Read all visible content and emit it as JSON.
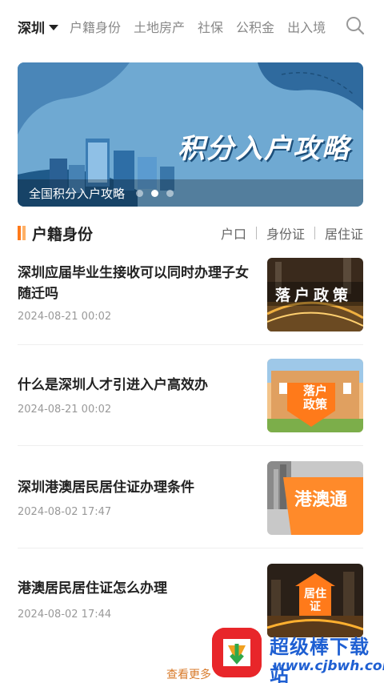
{
  "topnav": {
    "city": "深圳",
    "tabs": [
      "户籍身份",
      "土地房产",
      "社保",
      "公积金",
      "出入境"
    ]
  },
  "banner": {
    "title": "积分入户攻略",
    "caption": "全国积分入户攻略",
    "dots_count": 3,
    "active_dot": 1
  },
  "section": {
    "title": "户籍身份",
    "subtabs": [
      "户口",
      "身份证",
      "居住证"
    ]
  },
  "articles": [
    {
      "title": "深圳应届毕业生接收可以同时办理子女随迁吗",
      "date": "2024-08-21 00:02",
      "thumb_text": "落户政策"
    },
    {
      "title": "什么是深圳人才引进入户高效办",
      "date": "2024-08-21 00:02",
      "thumb_text": "落户政策"
    },
    {
      "title": "深圳港澳居民居住证办理条件",
      "date": "2024-08-02 17:47",
      "thumb_text": "港澳通"
    },
    {
      "title": "港澳居民居住证怎么办理",
      "date": "2024-08-02 17:44",
      "thumb_text": "居住证"
    }
  ],
  "more_label": "查看更多",
  "watermark": {
    "name": "超级棒下载站",
    "url": "www.cjbwh.com"
  },
  "colors": {
    "accent": "#ff7a1a",
    "banner_bg": "#6aa6cf",
    "watermark_blue": "#1e5fd2"
  }
}
